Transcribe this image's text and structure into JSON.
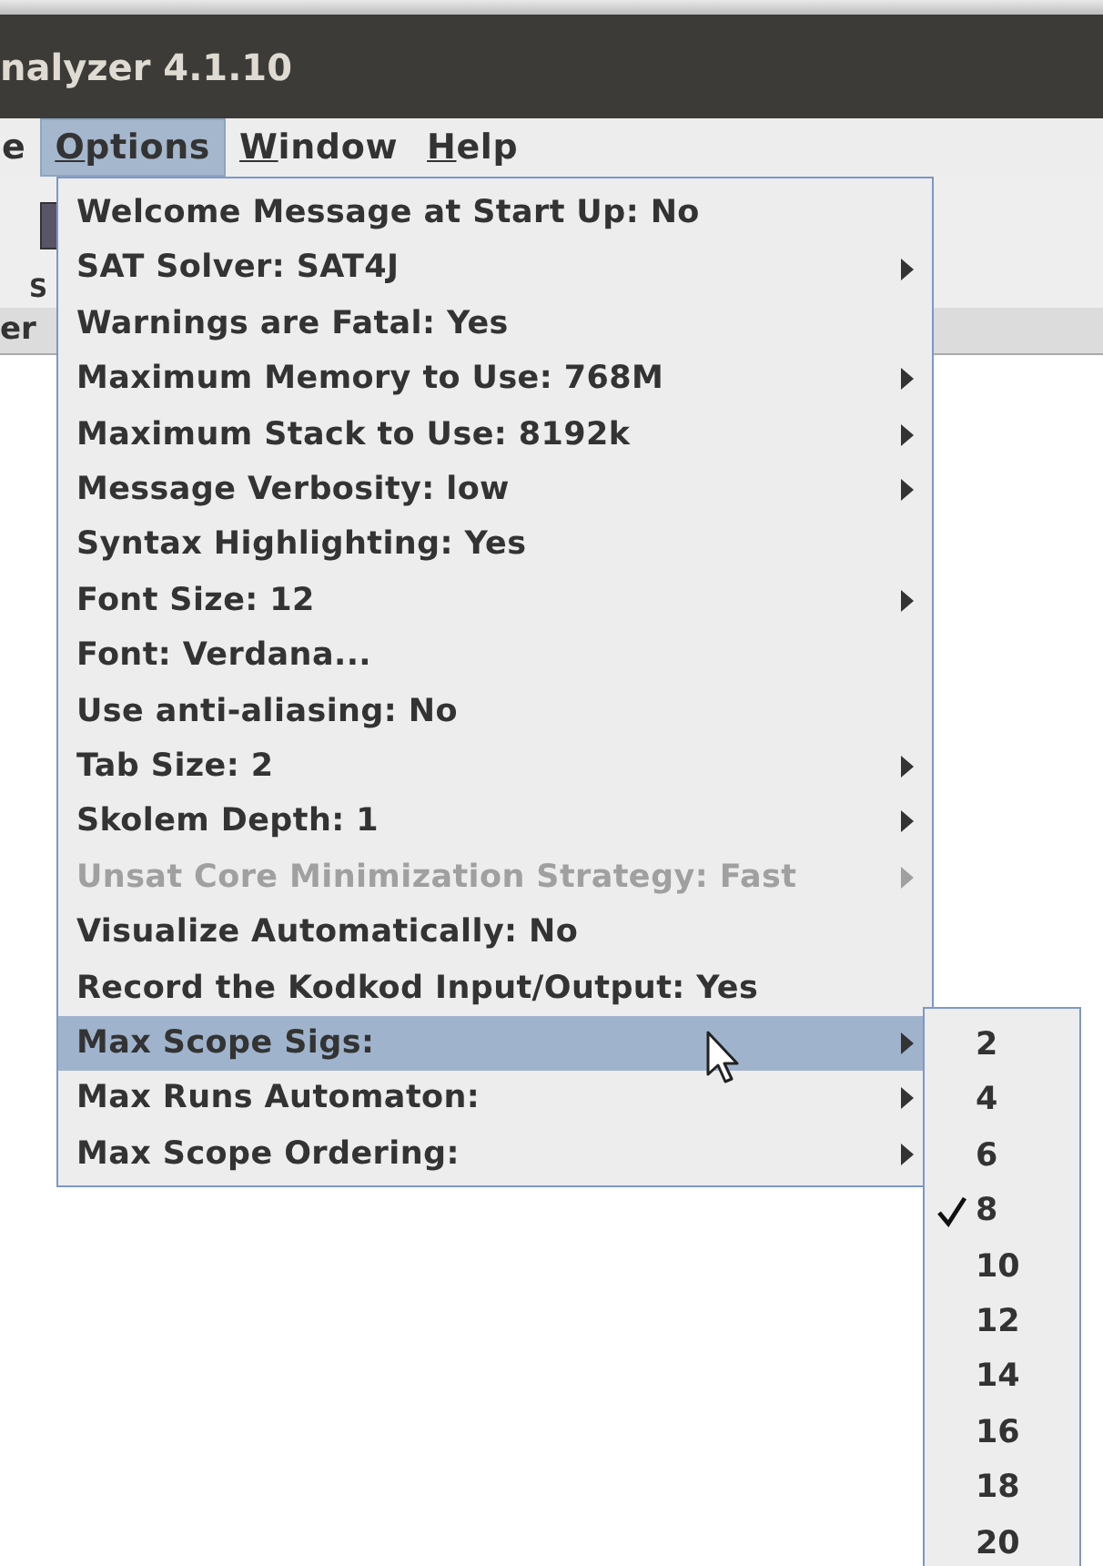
{
  "window": {
    "title": "nalyzer 4.1.10"
  },
  "menubar": [
    {
      "label": "e",
      "underline_first": false,
      "selected": false
    },
    {
      "label": "Options",
      "underline_first": true,
      "selected": true
    },
    {
      "label": "Window",
      "underline_first": true,
      "selected": false
    },
    {
      "label": "Help",
      "underline_first": true,
      "selected": false
    }
  ],
  "toolbar": {
    "label": "S"
  },
  "tab": {
    "label": "er"
  },
  "menu": [
    {
      "label": "Welcome Message at Start Up: No",
      "submenu": false,
      "disabled": false,
      "selected": false
    },
    {
      "label": "SAT Solver: SAT4J",
      "submenu": true,
      "disabled": false,
      "selected": false
    },
    {
      "label": "Warnings are Fatal: Yes",
      "submenu": false,
      "disabled": false,
      "selected": false
    },
    {
      "label": "Maximum Memory to Use: 768M",
      "submenu": true,
      "disabled": false,
      "selected": false
    },
    {
      "label": "Maximum Stack to Use: 8192k",
      "submenu": true,
      "disabled": false,
      "selected": false
    },
    {
      "label": "Message Verbosity: low",
      "submenu": true,
      "disabled": false,
      "selected": false
    },
    {
      "label": "Syntax Highlighting: Yes",
      "submenu": false,
      "disabled": false,
      "selected": false
    },
    {
      "label": "Font Size: 12",
      "submenu": true,
      "disabled": false,
      "selected": false
    },
    {
      "label": "Font: Verdana...",
      "submenu": false,
      "disabled": false,
      "selected": false
    },
    {
      "label": "Use anti-aliasing: No",
      "submenu": false,
      "disabled": false,
      "selected": false
    },
    {
      "label": "Tab Size: 2",
      "submenu": true,
      "disabled": false,
      "selected": false
    },
    {
      "label": "Skolem Depth: 1",
      "submenu": true,
      "disabled": false,
      "selected": false
    },
    {
      "label": "Unsat Core Minimization Strategy: Fast",
      "submenu": true,
      "disabled": true,
      "selected": false
    },
    {
      "label": "Visualize Automatically: No",
      "submenu": false,
      "disabled": false,
      "selected": false
    },
    {
      "label": "Record the Kodkod Input/Output: Yes",
      "submenu": false,
      "disabled": false,
      "selected": false
    },
    {
      "label": "Max Scope Sigs:",
      "submenu": true,
      "disabled": false,
      "selected": true
    },
    {
      "label": "Max Runs Automaton:",
      "submenu": true,
      "disabled": false,
      "selected": false
    },
    {
      "label": "Max Scope Ordering:",
      "submenu": true,
      "disabled": false,
      "selected": false
    }
  ],
  "submenu": [
    {
      "label": "2",
      "checked": false
    },
    {
      "label": "4",
      "checked": false
    },
    {
      "label": "6",
      "checked": false
    },
    {
      "label": "8",
      "checked": true
    },
    {
      "label": "10",
      "checked": false
    },
    {
      "label": "12",
      "checked": false
    },
    {
      "label": "14",
      "checked": false
    },
    {
      "label": "16",
      "checked": false
    },
    {
      "label": "18",
      "checked": false
    },
    {
      "label": "20",
      "checked": false
    }
  ]
}
